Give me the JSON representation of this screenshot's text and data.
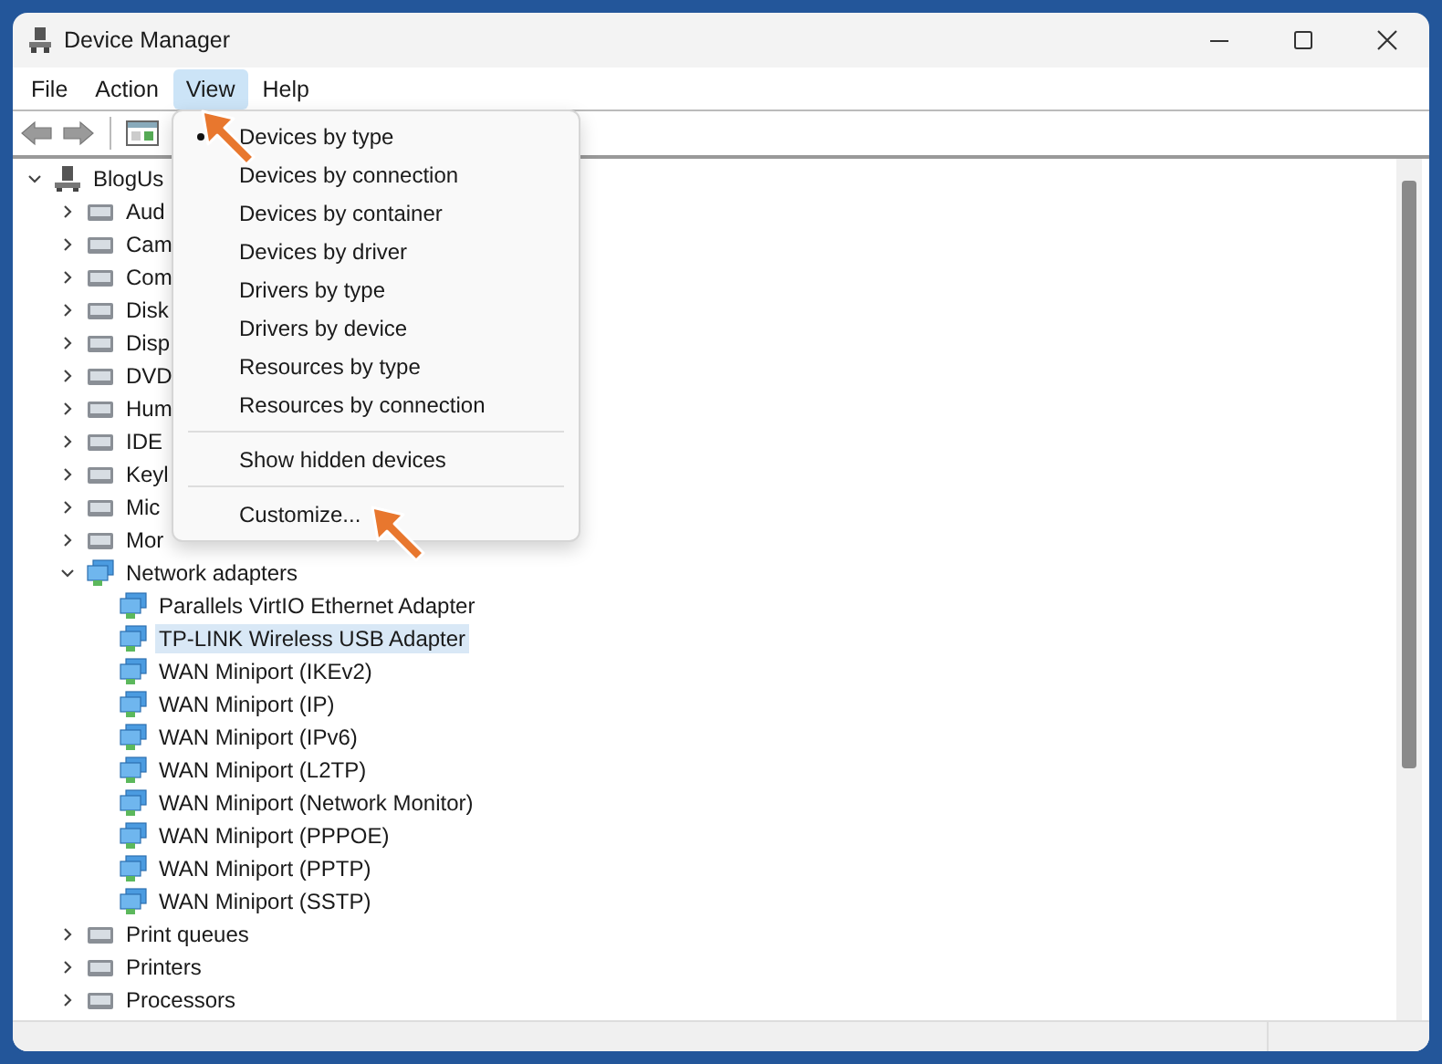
{
  "window": {
    "title": "Device Manager"
  },
  "menu_bar": [
    {
      "label": "File",
      "selected": false
    },
    {
      "label": "Action",
      "selected": false
    },
    {
      "label": "View",
      "selected": true
    },
    {
      "label": "Help",
      "selected": false
    }
  ],
  "view_menu": [
    {
      "kind": "item",
      "label": "Devices by type",
      "selected": true
    },
    {
      "kind": "item",
      "label": "Devices by connection",
      "selected": false
    },
    {
      "kind": "item",
      "label": "Devices by container",
      "selected": false
    },
    {
      "kind": "item",
      "label": "Devices by driver",
      "selected": false
    },
    {
      "kind": "item",
      "label": "Drivers by type",
      "selected": false
    },
    {
      "kind": "item",
      "label": "Drivers by device",
      "selected": false
    },
    {
      "kind": "item",
      "label": "Resources by type",
      "selected": false
    },
    {
      "kind": "item",
      "label": "Resources by connection",
      "selected": false
    },
    {
      "kind": "separator"
    },
    {
      "kind": "item",
      "label": "Show hidden devices",
      "selected": false
    },
    {
      "kind": "separator"
    },
    {
      "kind": "item",
      "label": "Customize...",
      "selected": false
    }
  ],
  "tree": {
    "label": "BlogUs",
    "expanded": true,
    "selected": false,
    "children": [
      {
        "label": "Aud",
        "expanded": false,
        "selected": false
      },
      {
        "label": "Cam",
        "expanded": false,
        "selected": false
      },
      {
        "label": "Com",
        "expanded": false,
        "selected": false
      },
      {
        "label": "Disk",
        "expanded": false,
        "selected": false
      },
      {
        "label": "Disp",
        "expanded": false,
        "selected": false
      },
      {
        "label": "DVD",
        "expanded": false,
        "selected": false
      },
      {
        "label": "Hum",
        "expanded": false,
        "selected": false
      },
      {
        "label": "IDE",
        "expanded": false,
        "selected": false
      },
      {
        "label": "Keyl",
        "expanded": false,
        "selected": false
      },
      {
        "label": "Mic",
        "expanded": false,
        "selected": false
      },
      {
        "label": "Mor",
        "expanded": false,
        "selected": false
      },
      {
        "label": "Network adapters",
        "expanded": true,
        "selected": false,
        "children": [
          {
            "label": "Parallels VirtIO Ethernet Adapter",
            "selected": false
          },
          {
            "label": "TP-LINK Wireless USB Adapter",
            "selected": true
          },
          {
            "label": "WAN Miniport (IKEv2)",
            "selected": false
          },
          {
            "label": "WAN Miniport (IP)",
            "selected": false
          },
          {
            "label": "WAN Miniport (IPv6)",
            "selected": false
          },
          {
            "label": "WAN Miniport (L2TP)",
            "selected": false
          },
          {
            "label": "WAN Miniport (Network Monitor)",
            "selected": false
          },
          {
            "label": "WAN Miniport (PPPOE)",
            "selected": false
          },
          {
            "label": "WAN Miniport (PPTP)",
            "selected": false
          },
          {
            "label": "WAN Miniport (SSTP)",
            "selected": false
          }
        ]
      },
      {
        "label": "Print queues",
        "expanded": false,
        "selected": false
      },
      {
        "label": "Printers",
        "expanded": false,
        "selected": false
      },
      {
        "label": "Processors",
        "expanded": false,
        "selected": false
      }
    ]
  }
}
